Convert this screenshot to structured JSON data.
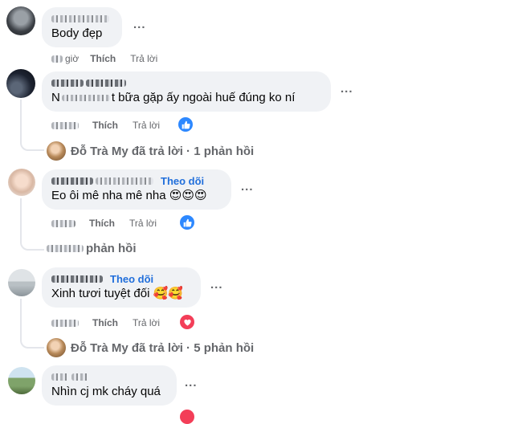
{
  "comments": [
    {
      "text": "Body đẹp",
      "follow": "",
      "actions": {
        "time_suffix": "giờ",
        "like": "Thích",
        "reply": "Trả lời"
      },
      "more": "..."
    },
    {
      "text_prefix": "N",
      "text": "t bữa gặp ấy ngoài huế đúng ko ní",
      "follow": "",
      "actions": {
        "like": "Thích",
        "reply": "Trả lời"
      },
      "reaction": "like",
      "more": "...",
      "replies": {
        "author": "Đỗ Trà My",
        "label": "đã trả lời · 1 phản hồi"
      }
    },
    {
      "text": "Eo ôi mê nha mê nha",
      "emojis": "😍😍😍",
      "follow": "Theo dõi",
      "actions": {
        "like": "Thích",
        "reply": "Trả lời"
      },
      "reaction": "like",
      "more": "...",
      "replies": {
        "label": "phản hồi"
      }
    },
    {
      "text": "Xinh tươi tuyệt đối",
      "emojis": "🥰🥰",
      "follow": "Theo dõi",
      "actions": {
        "like": "Thích",
        "reply": "Trả lời"
      },
      "reaction": "heart",
      "more": "...",
      "replies": {
        "author": "Đỗ Trà My",
        "label": "đã trả lời · 5 phản hồi"
      }
    },
    {
      "text": "Nhìn cj mk cháy quá",
      "follow": "",
      "more": "..."
    }
  ],
  "colors": {
    "bubble": "#f0f2f5",
    "follow": "#216fdb",
    "muted": "#65676b",
    "like_blue": "#2d88ff",
    "heart_red": "#f33e58"
  },
  "icons": [
    "thumbs-up-icon",
    "heart-icon",
    "more-options-icon",
    "avatar"
  ]
}
